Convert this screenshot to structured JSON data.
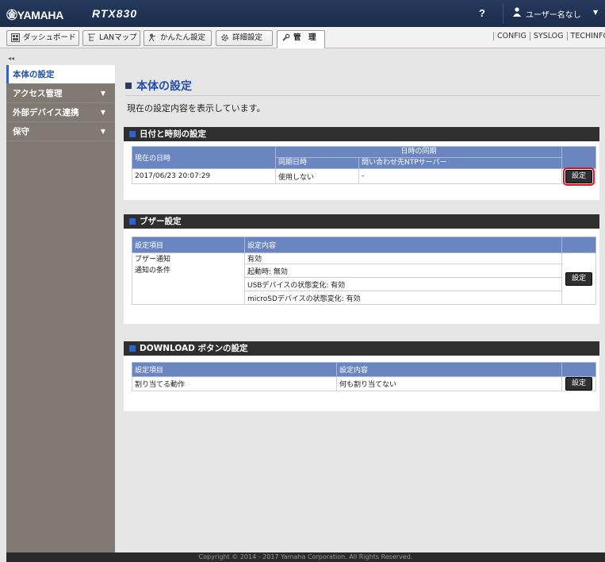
{
  "header": {
    "logo": "㊎YAMAHA",
    "model": "RTX830",
    "help": "?",
    "user": "ユーザー名なし"
  },
  "tabs": [
    {
      "label": "ダッシュボード"
    },
    {
      "label": "LANマップ"
    },
    {
      "label": "かんたん設定"
    },
    {
      "label": "詳細設定"
    },
    {
      "label": "管　理"
    }
  ],
  "toplinks": [
    "CONFIG",
    "SYSLOG",
    "TECHINFO"
  ],
  "sidebar": {
    "collapse": "◂◂",
    "items": [
      {
        "label": "本体の設定"
      },
      {
        "label": "アクセス管理"
      },
      {
        "label": "外部デバイス連携"
      },
      {
        "label": "保守"
      }
    ]
  },
  "page": {
    "title": "本体の設定",
    "subtitle": "現在の設定内容を表示しています。"
  },
  "datetime": {
    "title": "日付と時刻の設定",
    "h_current": "現在の日時",
    "h_sync": "日時の同期",
    "h_sync_date": "同期日時",
    "h_ntp": "問い合わせ先NTPサーバー",
    "current": "2017/06/23 20:07:29",
    "sync_date": "使用しない",
    "ntp": "-",
    "button": "設定"
  },
  "buzzer": {
    "title": "ブザー設定",
    "h_item": "設定項目",
    "h_content": "設定内容",
    "r1_item": "ブザー通知",
    "r1_value": "有効",
    "r2_item": "通知の条件",
    "c1": "起動時: 無効",
    "c2": "USBデバイスの状態変化: 有効",
    "c3": "microSDデバイスの状態変化: 有効",
    "button": "設定"
  },
  "download": {
    "title": "DOWNLOAD ボタンの設定",
    "h_item": "設定項目",
    "h_content": "設定内容",
    "item": "割り当てる動作",
    "value": "何も割り当てない",
    "button": "設定"
  },
  "footer": "Copyright © 2014 - 2017 Yamaha Corporation. All Rights Reserved."
}
